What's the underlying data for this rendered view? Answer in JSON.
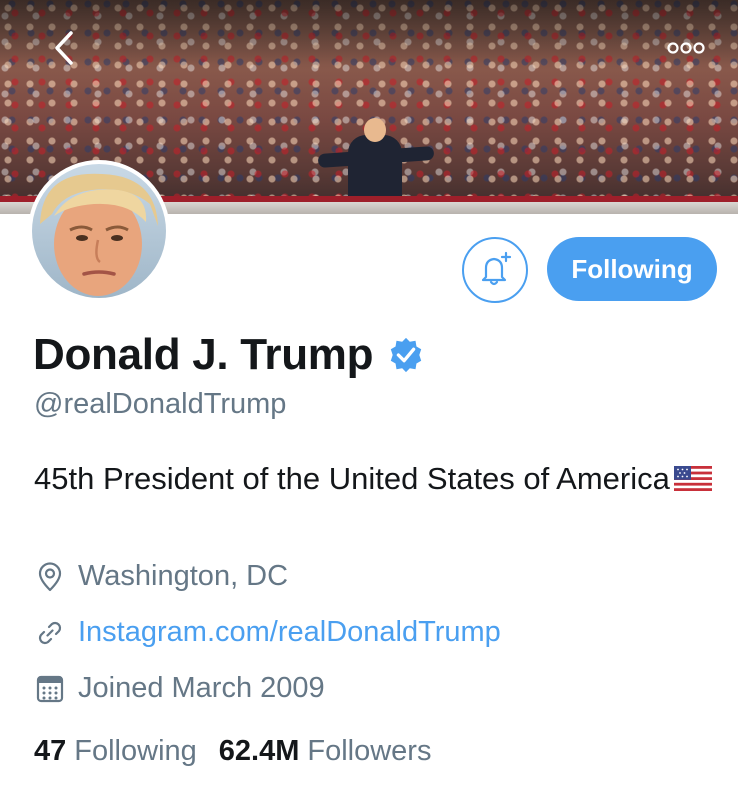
{
  "header": {
    "back_icon": "chevron-left-icon",
    "more_icon": "more-horizontal-icon"
  },
  "actions": {
    "notify_icon": "bell-plus-icon",
    "follow_label": "Following",
    "accent_color": "#4a9ff0"
  },
  "profile": {
    "name": "Donald J. Trump",
    "verified_icon": "verified-badge-icon",
    "handle": "@realDonaldTrump",
    "bio": "45th President of the United States of America",
    "bio_emoji": "us-flag-emoji",
    "location_icon": "location-pin-icon",
    "location": "Washington, DC",
    "link_icon": "link-icon",
    "link": "Instagram.com/realDonaldTrump",
    "joined_icon": "calendar-icon",
    "joined": "Joined March 2009"
  },
  "stats": {
    "following_count": "47",
    "following_label": "Following",
    "followers_count": "62.4M",
    "followers_label": "Followers"
  }
}
